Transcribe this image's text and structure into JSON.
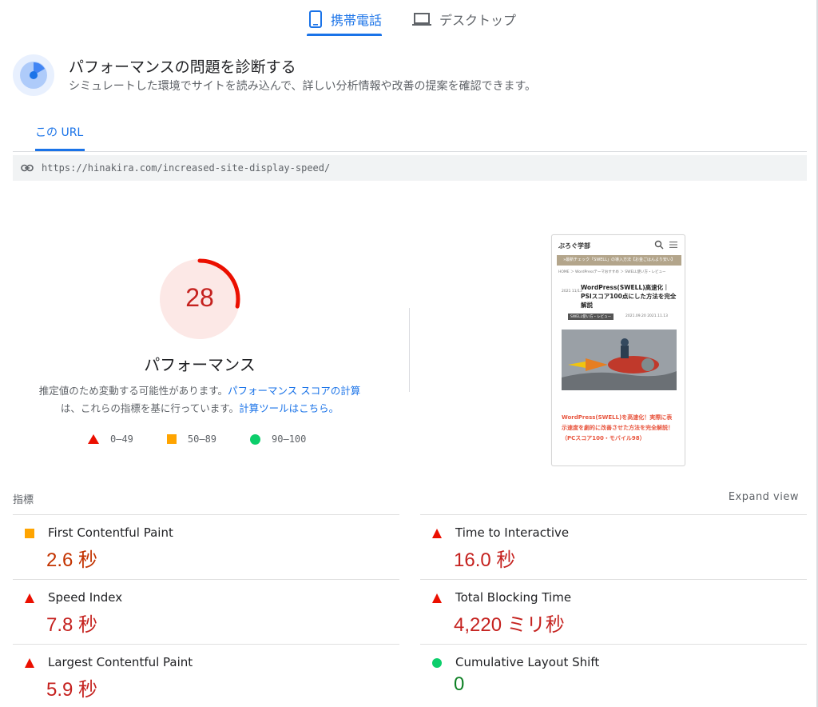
{
  "device_tabs": {
    "mobile_label": "携帯電話",
    "desktop_label": "デスクトップ"
  },
  "diagnose": {
    "title": "パフォーマンスの問題を診断する",
    "subtitle": "シミュレートした環境でサイトを読み込んで、詳しい分析情報や改善の提案を確認できます。"
  },
  "url_tab": {
    "label": "この URL"
  },
  "url_bar": {
    "url": "https://hinakira.com/increased-site-display-speed/"
  },
  "score": {
    "value": "28",
    "fraction": 0.28,
    "label": "パフォーマンス",
    "desc_part1": "推定値のため変動する可能性があります。",
    "desc_link1": "パフォーマンス スコアの計算",
    "desc_part2": "は、これらの指標を基に行っています。",
    "desc_link2": "計算ツールはこちら。",
    "color": "#c5221f"
  },
  "legend": [
    {
      "shape": "triangle",
      "range": "0–49",
      "color": "#eb0f00"
    },
    {
      "shape": "square",
      "range": "50–89",
      "color": "#ffa400"
    },
    {
      "shape": "circle",
      "range": "90–100",
      "color": "#0cce6b"
    }
  ],
  "preview": {
    "site_name": "ぶろぐ学部",
    "banner": "»最新チェック「SWELL」の導入方法【お金ごはんより安い】",
    "breadcrumb": "HOME ＞ WordPressテーマおすすめ ＞ SWELL使い方・レビュー",
    "date": "2021 11/13",
    "title": "WordPress(SWELL)高速化｜PSIスコア100点にした方法を完全解説",
    "tag": "SWELL使い方・レビュー",
    "meta": "2021.09.20  2021.11.13",
    "excerpt": "WordPress(SWELL)を高速化！実際に表示速度を劇的に改善させた方法を完全解説！（PCスコア100・モバイル98）"
  },
  "metrics_header": {
    "label": "指標",
    "expand": "Expand view"
  },
  "metrics": {
    "fcp": {
      "name": "First Contentful Paint",
      "value": "2.6 秒",
      "status": "average"
    },
    "tti": {
      "name": "Time to Interactive",
      "value": "16.0 秒",
      "status": "fail"
    },
    "si": {
      "name": "Speed Index",
      "value": "7.8 秒",
      "status": "fail"
    },
    "tbt": {
      "name": "Total Blocking Time",
      "value": "4,220 ミリ秒",
      "status": "fail"
    },
    "lcp": {
      "name": "Largest Contentful Paint",
      "value": "5.9 秒",
      "status": "fail"
    },
    "cls": {
      "name": "Cumulative Layout Shift",
      "value": "0",
      "status": "pass"
    }
  },
  "colors": {
    "accent": "#1a73e8",
    "fail": "#eb0f00",
    "average": "#ffa400",
    "pass": "#0cce6b"
  }
}
